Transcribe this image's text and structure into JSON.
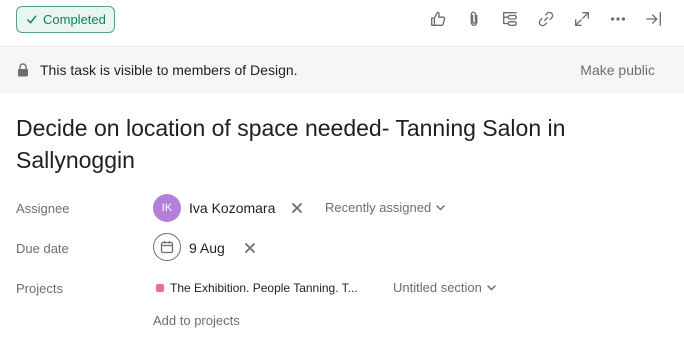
{
  "toolbar": {
    "completed_label": "Completed",
    "icons": [
      "thumbs-up-icon",
      "attachment-icon",
      "subtask-icon",
      "link-icon",
      "expand-icon",
      "more-icon",
      "close-pane-icon"
    ]
  },
  "privacy": {
    "message": "This task is visible to members of Design.",
    "make_public_label": "Make public"
  },
  "task": {
    "title": "Decide on location of space needed- Tanning Salon in Sallynoggin"
  },
  "fields": {
    "assignee": {
      "label": "Assignee",
      "initials": "IK",
      "name": "Iva Kozomara",
      "dropdown": "Recently assigned"
    },
    "due_date": {
      "label": "Due date",
      "value": "9 Aug"
    },
    "projects": {
      "label": "Projects",
      "project_name": "The Exhibition. People Tanning. T...",
      "section": "Untitled section",
      "add_label": "Add to projects"
    }
  },
  "colors": {
    "completed_border": "#58a182",
    "completed_text": "#0d7f56",
    "avatar_bg": "#b37fd8",
    "project_dot": "#f06a99",
    "privacy_bg": "#f6f6f6"
  }
}
